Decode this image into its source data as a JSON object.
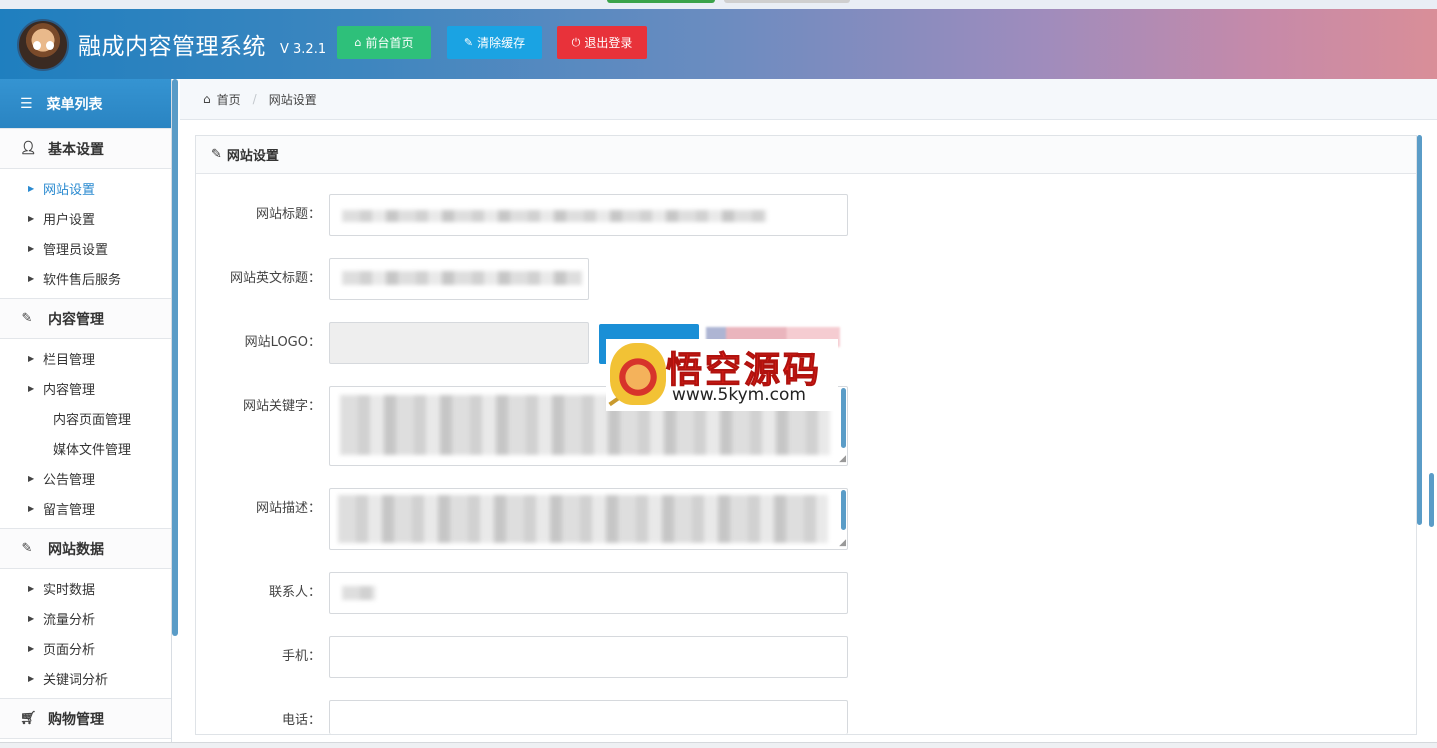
{
  "app": {
    "title": "融成内容管理系统",
    "version": "V 3.2.1"
  },
  "header_buttons": {
    "home": "前台首页",
    "cache": "清除缓存",
    "logout": "退出登录"
  },
  "sidebar": {
    "menu_title": "菜单列表",
    "groups": [
      {
        "label": "基本设置",
        "icon": "user-icon",
        "items": [
          {
            "label": "网站设置",
            "active": true
          },
          {
            "label": "用户设置"
          },
          {
            "label": "管理员设置"
          },
          {
            "label": "软件售后服务"
          }
        ]
      },
      {
        "label": "内容管理",
        "icon": "edit-icon",
        "items": [
          {
            "label": "栏目管理"
          },
          {
            "label": "内容管理"
          },
          {
            "label": "内容页面管理",
            "sub": true
          },
          {
            "label": "媒体文件管理",
            "sub": true
          },
          {
            "label": "公告管理"
          },
          {
            "label": "留言管理"
          }
        ]
      },
      {
        "label": "网站数据",
        "icon": "edit-icon",
        "items": [
          {
            "label": "实时数据"
          },
          {
            "label": "流量分析"
          },
          {
            "label": "页面分析"
          },
          {
            "label": "关键词分析"
          }
        ]
      },
      {
        "label": "购物管理",
        "icon": "cart-icon",
        "items": []
      }
    ]
  },
  "breadcrumb": {
    "home": "首页",
    "current": "网站设置"
  },
  "panel": {
    "title": "网站设置"
  },
  "form": {
    "site_title_label": "网站标题：",
    "site_en_title_label": "网站英文标题：",
    "site_logo_label": "网站LOGO：",
    "site_keywords_label": "网站关键字：",
    "site_desc_label": "网站描述：",
    "contact_label": "联系人：",
    "mobile_label": "手机：",
    "phone_label": "电话："
  },
  "watermark": {
    "name": "悟空源码",
    "url": "www.5kym.com"
  },
  "colors": {
    "accent": "#2a8ad0",
    "home_btn": "#2ec07a",
    "cache_btn": "#1aa3e3",
    "logout_btn": "#e8323a"
  }
}
